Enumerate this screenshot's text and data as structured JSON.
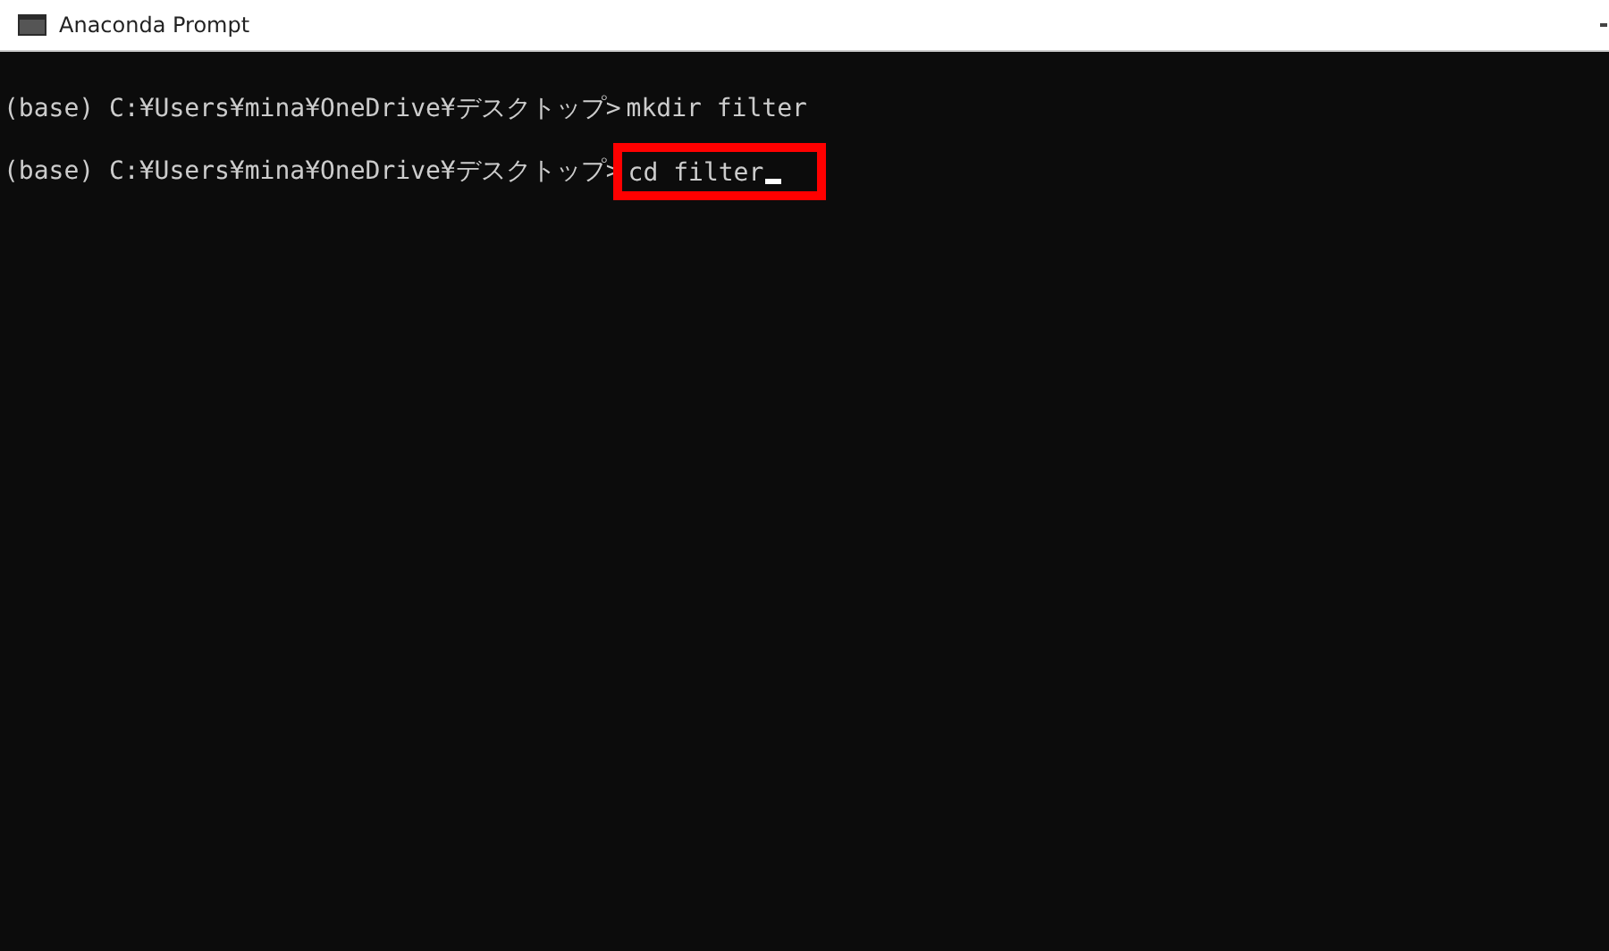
{
  "window": {
    "title": "Anaconda Prompt"
  },
  "lines": [
    {
      "prompt": "(base) C:¥Users¥mina¥OneDrive¥デスクトップ>",
      "command": "mkdir filter",
      "highlighted": false,
      "cursor": false
    },
    {
      "prompt": "(base) C:¥Users¥mina¥OneDrive¥デスクトップ>",
      "command": "cd filter",
      "highlighted": true,
      "cursor": true
    }
  ]
}
